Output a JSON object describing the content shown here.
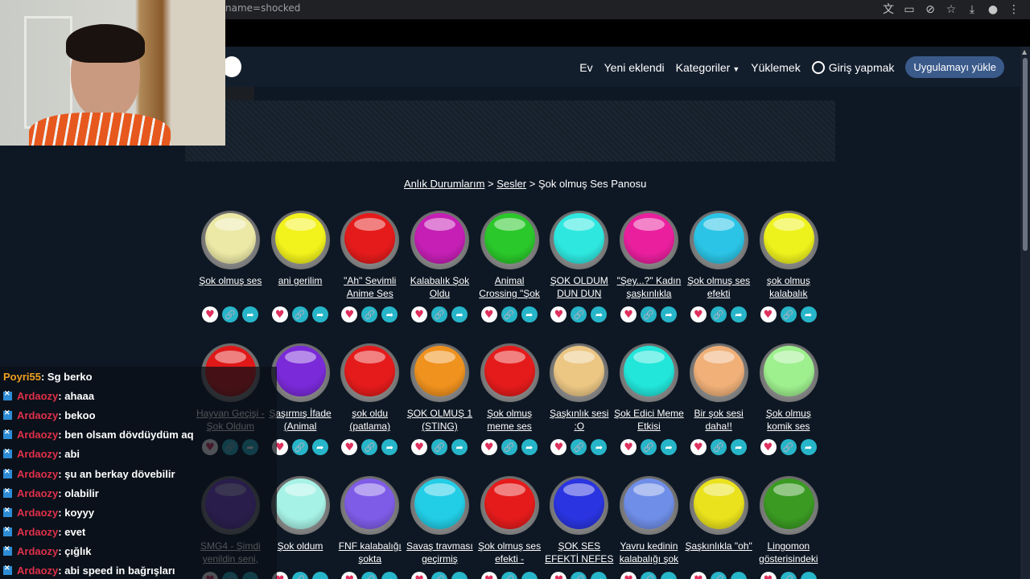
{
  "browser": {
    "url_fragment": "name=shocked",
    "icons": [
      "translate-icon",
      "cast-icon",
      "eye-off-icon",
      "star-icon",
      "download-icon",
      "profile-icon",
      "more-icon"
    ]
  },
  "nav": {
    "home": "Ev",
    "new": "Yeni eklendi",
    "categories": "Kategoriler",
    "upload": "Yüklemek",
    "login": "Giriş yapmak",
    "install": "Uygulamayı yükle"
  },
  "breadcrumb": {
    "part1": "Anlık Durumlarım",
    "sep1": " > ",
    "part2": "Sesler",
    "sep2": " > ",
    "current": "Şok olmuş Ses Panosu"
  },
  "buttons": [
    {
      "title": "Şok olmuş ses",
      "color": "#ece9a6"
    },
    {
      "title": "ani gerilim",
      "color": "#f2f21c"
    },
    {
      "title": "\"Ah\" Sevimli Anime Ses",
      "color": "#e51b1b"
    },
    {
      "title": "Kalabalık Şok Oldu",
      "color": "#c51fb5"
    },
    {
      "title": "Animal Crossing \"Şok",
      "color": "#2ac82a"
    },
    {
      "title": "ŞOK OLDUM DUN DUN",
      "color": "#2ee8e0"
    },
    {
      "title": "\"Şey...?\" Kadın şaşkınlıkla",
      "color": "#ea1f9e"
    },
    {
      "title": "Şok olmuş ses efekti",
      "color": "#2bc4e6"
    },
    {
      "title": "şok olmuş kalabalık",
      "color": "#eef21c"
    },
    {
      "title": "Hayvan Geçişi - Şok Oldum",
      "color": "#e01818"
    },
    {
      "title": "Şaşırmış İfade (Animal",
      "color": "#7a2ad8"
    },
    {
      "title": "şok oldu (patlama)",
      "color": "#e51b1b"
    },
    {
      "title": "ŞOK OLMUŞ 1 (STING)",
      "color": "#f0921e"
    },
    {
      "title": "Şok olmuş meme ses",
      "color": "#e51b1b"
    },
    {
      "title": "Şaşkınlık sesi :O",
      "color": "#ecc784"
    },
    {
      "title": "Şok Edici Meme Etkisi",
      "color": "#22e6da"
    },
    {
      "title": "Bir şok sesi daha!!",
      "color": "#f0b078"
    },
    {
      "title": "Şok olmuş komik ses",
      "color": "#9ef08e"
    },
    {
      "title": "SMG4 - Şimdi yenildin seni,",
      "color": "#7b43d4"
    },
    {
      "title": "Şok oldum",
      "color": "#a7f2e6"
    },
    {
      "title": "FNF kalabalığı şokta",
      "color": "#7f5ce8"
    },
    {
      "title": "Savaş travması geçirmiş",
      "color": "#22cde6"
    },
    {
      "title": "Şok olmuş ses efekti -",
      "color": "#e51b1b"
    },
    {
      "title": "ŞOK SES EFEKTİ NEFES",
      "color": "#2a34e0"
    },
    {
      "title": "Yavru kedinin kalabalığı şok",
      "color": "#6f8ee8"
    },
    {
      "title": "Şaşkınlıkla \"oh\"",
      "color": "#eae21c"
    },
    {
      "title": "Lingomon gösterisindeki",
      "color": "#3a9a22"
    }
  ],
  "chat": [
    {
      "user": "Poyri55",
      "text": " : Sg berko",
      "badge": false,
      "user_color": "#f0a020"
    },
    {
      "user": "Ardaozy",
      "text": " : ahaaa",
      "badge": true,
      "user_color": "#e0304a"
    },
    {
      "user": "Ardaozy",
      "text": " : bekoo",
      "badge": true,
      "user_color": "#e0304a"
    },
    {
      "user": "Ardaozy",
      "text": " : ben olsam dövdüydüm aq",
      "badge": true,
      "user_color": "#e0304a"
    },
    {
      "user": "Ardaozy",
      "text": " : abi",
      "badge": true,
      "user_color": "#e0304a"
    },
    {
      "user": "Ardaozy",
      "text": " : şu an berkay dövebilir",
      "badge": true,
      "user_color": "#e0304a"
    },
    {
      "user": "Ardaozy",
      "text": " : olabilir",
      "badge": true,
      "user_color": "#e0304a"
    },
    {
      "user": "Ardaozy",
      "text": " : koyyy",
      "badge": true,
      "user_color": "#e0304a"
    },
    {
      "user": "Ardaozy",
      "text": " : evet",
      "badge": true,
      "user_color": "#e0304a"
    },
    {
      "user": "Ardaozy",
      "text": " : çığlık",
      "badge": true,
      "user_color": "#e0304a"
    },
    {
      "user": "Ardaozy",
      "text": " : abi speed in bağrışları",
      "badge": true,
      "user_color": "#e0304a"
    }
  ]
}
